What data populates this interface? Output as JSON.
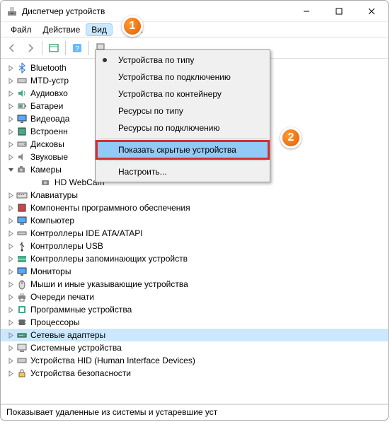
{
  "title": "Диспетчер устройств",
  "menu": {
    "file": "Файл",
    "action": "Действие",
    "view": "Вид",
    "help": "ка"
  },
  "dropdown": {
    "i0": "Устройства по типу",
    "i1": "Устройства по подключению",
    "i2": "Устройства по контейнеру",
    "i3": "Ресурсы по типу",
    "i4": "Ресурсы по подключению",
    "i5": "Показать скрытые устройства",
    "i6": "Настроить..."
  },
  "tree": {
    "n0": "Bluetooth",
    "n1": "MTD-устр",
    "n2": "Аудиовхо",
    "n3": "Батареи",
    "n4": "Видеоада",
    "n5": "Встроенн",
    "n6": "Дисковы",
    "n7": "Звуковые",
    "n8": "Камеры",
    "n8a": "HD WebCam",
    "n9": "Клавиатуры",
    "n10": "Компоненты программного обеспечения",
    "n11": "Компьютер",
    "n12": "Контроллеры IDE ATA/ATAPI",
    "n13": "Контроллеры USB",
    "n14": "Контроллеры запоминающих устройств",
    "n15": "Мониторы",
    "n16": "Мыши и иные указывающие устройства",
    "n17": "Очереди печати",
    "n18": "Программные устройства",
    "n19": "Процессоры",
    "n20": "Сетевые адаптеры",
    "n21": "Системные устройства",
    "n22": "Устройства HID (Human Interface Devices)",
    "n23": "Устройства безопасности"
  },
  "status": "Показывает удаленные из системы и устаревшие уст",
  "annot": {
    "a1": "1",
    "a2": "2"
  }
}
